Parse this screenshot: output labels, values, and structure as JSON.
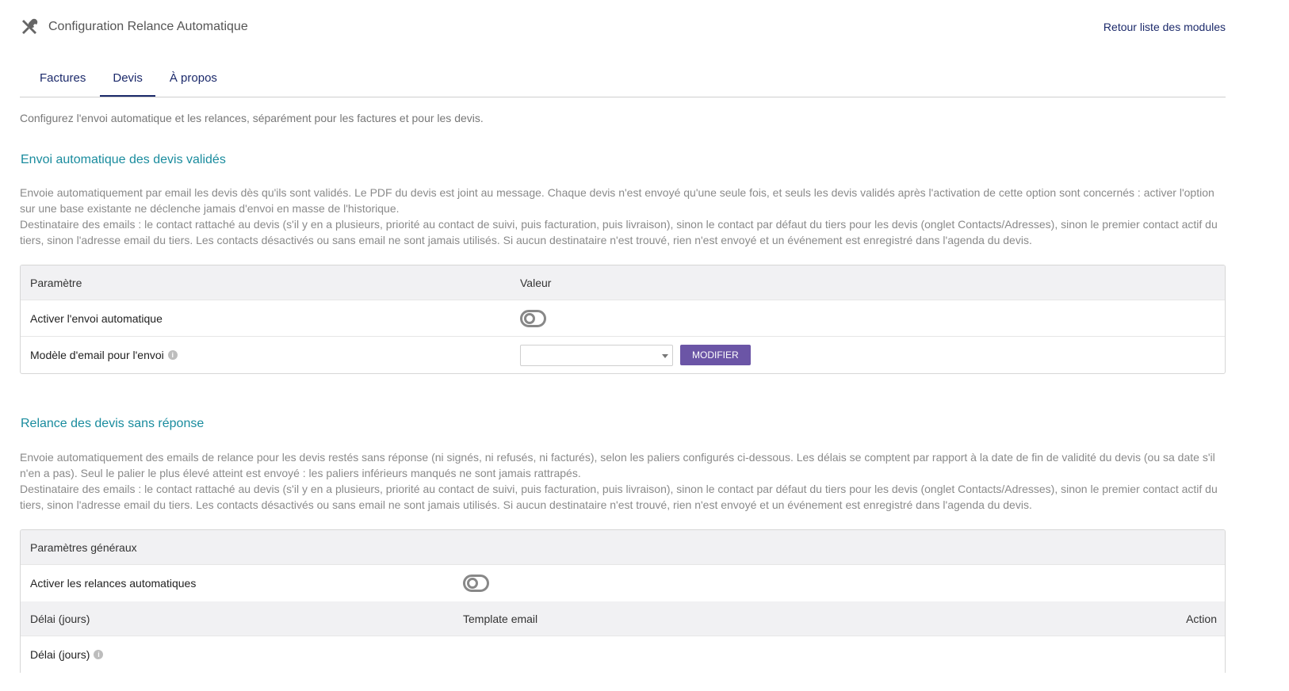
{
  "header": {
    "title": "Configuration Relance Automatique",
    "back_link": "Retour liste des modules"
  },
  "tabs": [
    {
      "label": "Factures",
      "active": false
    },
    {
      "label": "Devis",
      "active": true
    },
    {
      "label": "À propos",
      "active": false
    }
  ],
  "intro": "Configurez l'envoi automatique et les relances, séparément pour les factures et pour les devis.",
  "auto_send": {
    "title": "Envoi automatique des devis validés",
    "desc1": "Envoie automatiquement par email les devis dès qu'ils sont validés. Le PDF du devis est joint au message. Chaque devis n'est envoyé qu'une seule fois, et seuls les devis validés après l'activation de cette option sont concernés : activer l'option sur une base existante ne déclenche jamais d'envoi en masse de l'historique.",
    "desc2": "Destinataire des emails : le contact rattaché au devis (s'il y en a plusieurs, priorité au contact de suivi, puis facturation, puis livraison), sinon le contact par défaut du tiers pour les devis (onglet Contacts/Adresses), sinon le premier contact actif du tiers, sinon l'adresse email du tiers. Les contacts désactivés ou sans email ne sont jamais utilisés. Si aucun destinataire n'est trouvé, rien n'est envoyé et un événement est enregistré dans l'agenda du devis.",
    "col_param": "Paramètre",
    "col_value": "Valeur",
    "enable_label": "Activer l'envoi automatique",
    "enabled": false,
    "template_label": "Modèle d'email pour l'envoi",
    "template_value": "",
    "modify_button": "MODIFIER"
  },
  "reminders": {
    "title": "Relance des devis sans réponse",
    "desc1": "Envoie automatiquement des emails de relance pour les devis restés sans réponse (ni signés, ni refusés, ni facturés), selon les paliers configurés ci-dessous. Les délais se comptent par rapport à la date de fin de validité du devis (ou sa date s'il n'en a pas). Seul le palier le plus élevé atteint est envoyé : les paliers inférieurs manqués ne sont jamais rattrapés.",
    "desc2": "Destinataire des emails : le contact rattaché au devis (s'il y en a plusieurs, priorité au contact de suivi, puis facturation, puis livraison), sinon le contact par défaut du tiers pour les devis (onglet Contacts/Adresses), sinon le premier contact actif du tiers, sinon l'adresse email du tiers. Les contacts désactivés ou sans email ne sont jamais utilisés. Si aucun destinataire n'est trouvé, rien n'est envoyé et un événement est enregistré dans l'agenda du devis.",
    "general_header": "Paramètres généraux",
    "enable_label": "Activer les relances automatiques",
    "enabled": false,
    "col_delay": "Délai (jours)",
    "col_template": "Template email",
    "col_action": "Action",
    "delay_row_label": "Délai (jours)"
  }
}
